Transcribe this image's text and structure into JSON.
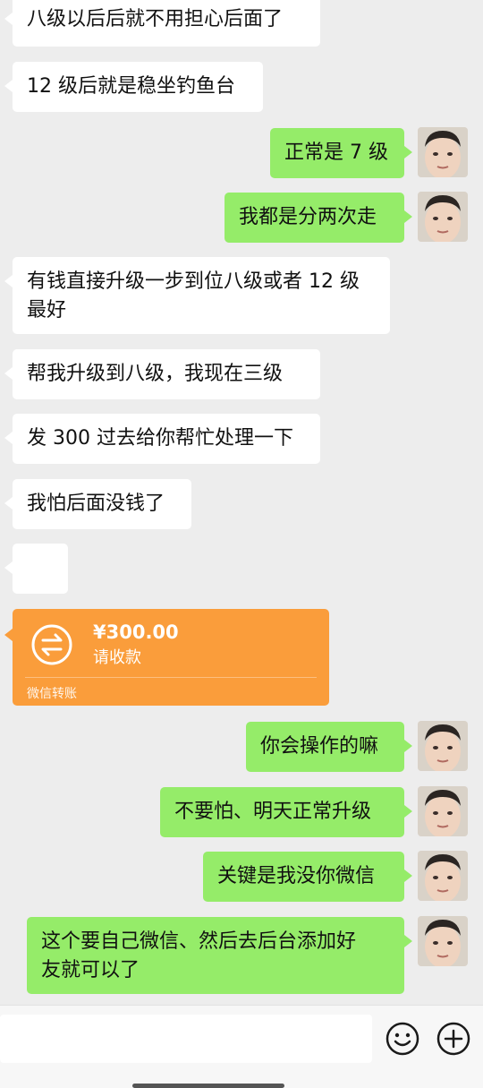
{
  "messages": [
    {
      "side": "in",
      "text": "八级以后后就不用担心后面了"
    },
    {
      "side": "in",
      "text": "12 级后就是稳坐钓鱼台"
    },
    {
      "side": "out",
      "text": "正常是 7 级"
    },
    {
      "side": "out",
      "text": "我都是分两次走"
    },
    {
      "side": "in",
      "text": "有钱直接升级一步到位八级或者 12 级\n最好"
    },
    {
      "side": "in",
      "text": "帮我升级到八级，我现在三级"
    },
    {
      "side": "in",
      "text": "发 300 过去给你帮忙处理一下"
    },
    {
      "side": "in",
      "text": "我怕后面没钱了"
    },
    {
      "side": "in",
      "emoji": "crying-laughing-emoji"
    },
    {
      "side": "out",
      "text": "你会操作的嘛"
    },
    {
      "side": "out",
      "text": "不要怕、明天正常升级"
    },
    {
      "side": "out",
      "text": "关键是我没你微信"
    },
    {
      "side": "out",
      "text": "这个要自己微信、然后去后台添加好\n友就可以了"
    }
  ],
  "transfer": {
    "amount": "¥300.00",
    "status": "请收款",
    "footer": "微信转账",
    "color": "#fa9d3b"
  },
  "colors": {
    "background": "#ededed",
    "incoming_bubble": "#ffffff",
    "outgoing_bubble": "#95ec69"
  },
  "input": {
    "value": "",
    "placeholder": ""
  },
  "icons": {
    "emoji_button": "smiley-icon",
    "more_button": "plus-circle-icon"
  }
}
